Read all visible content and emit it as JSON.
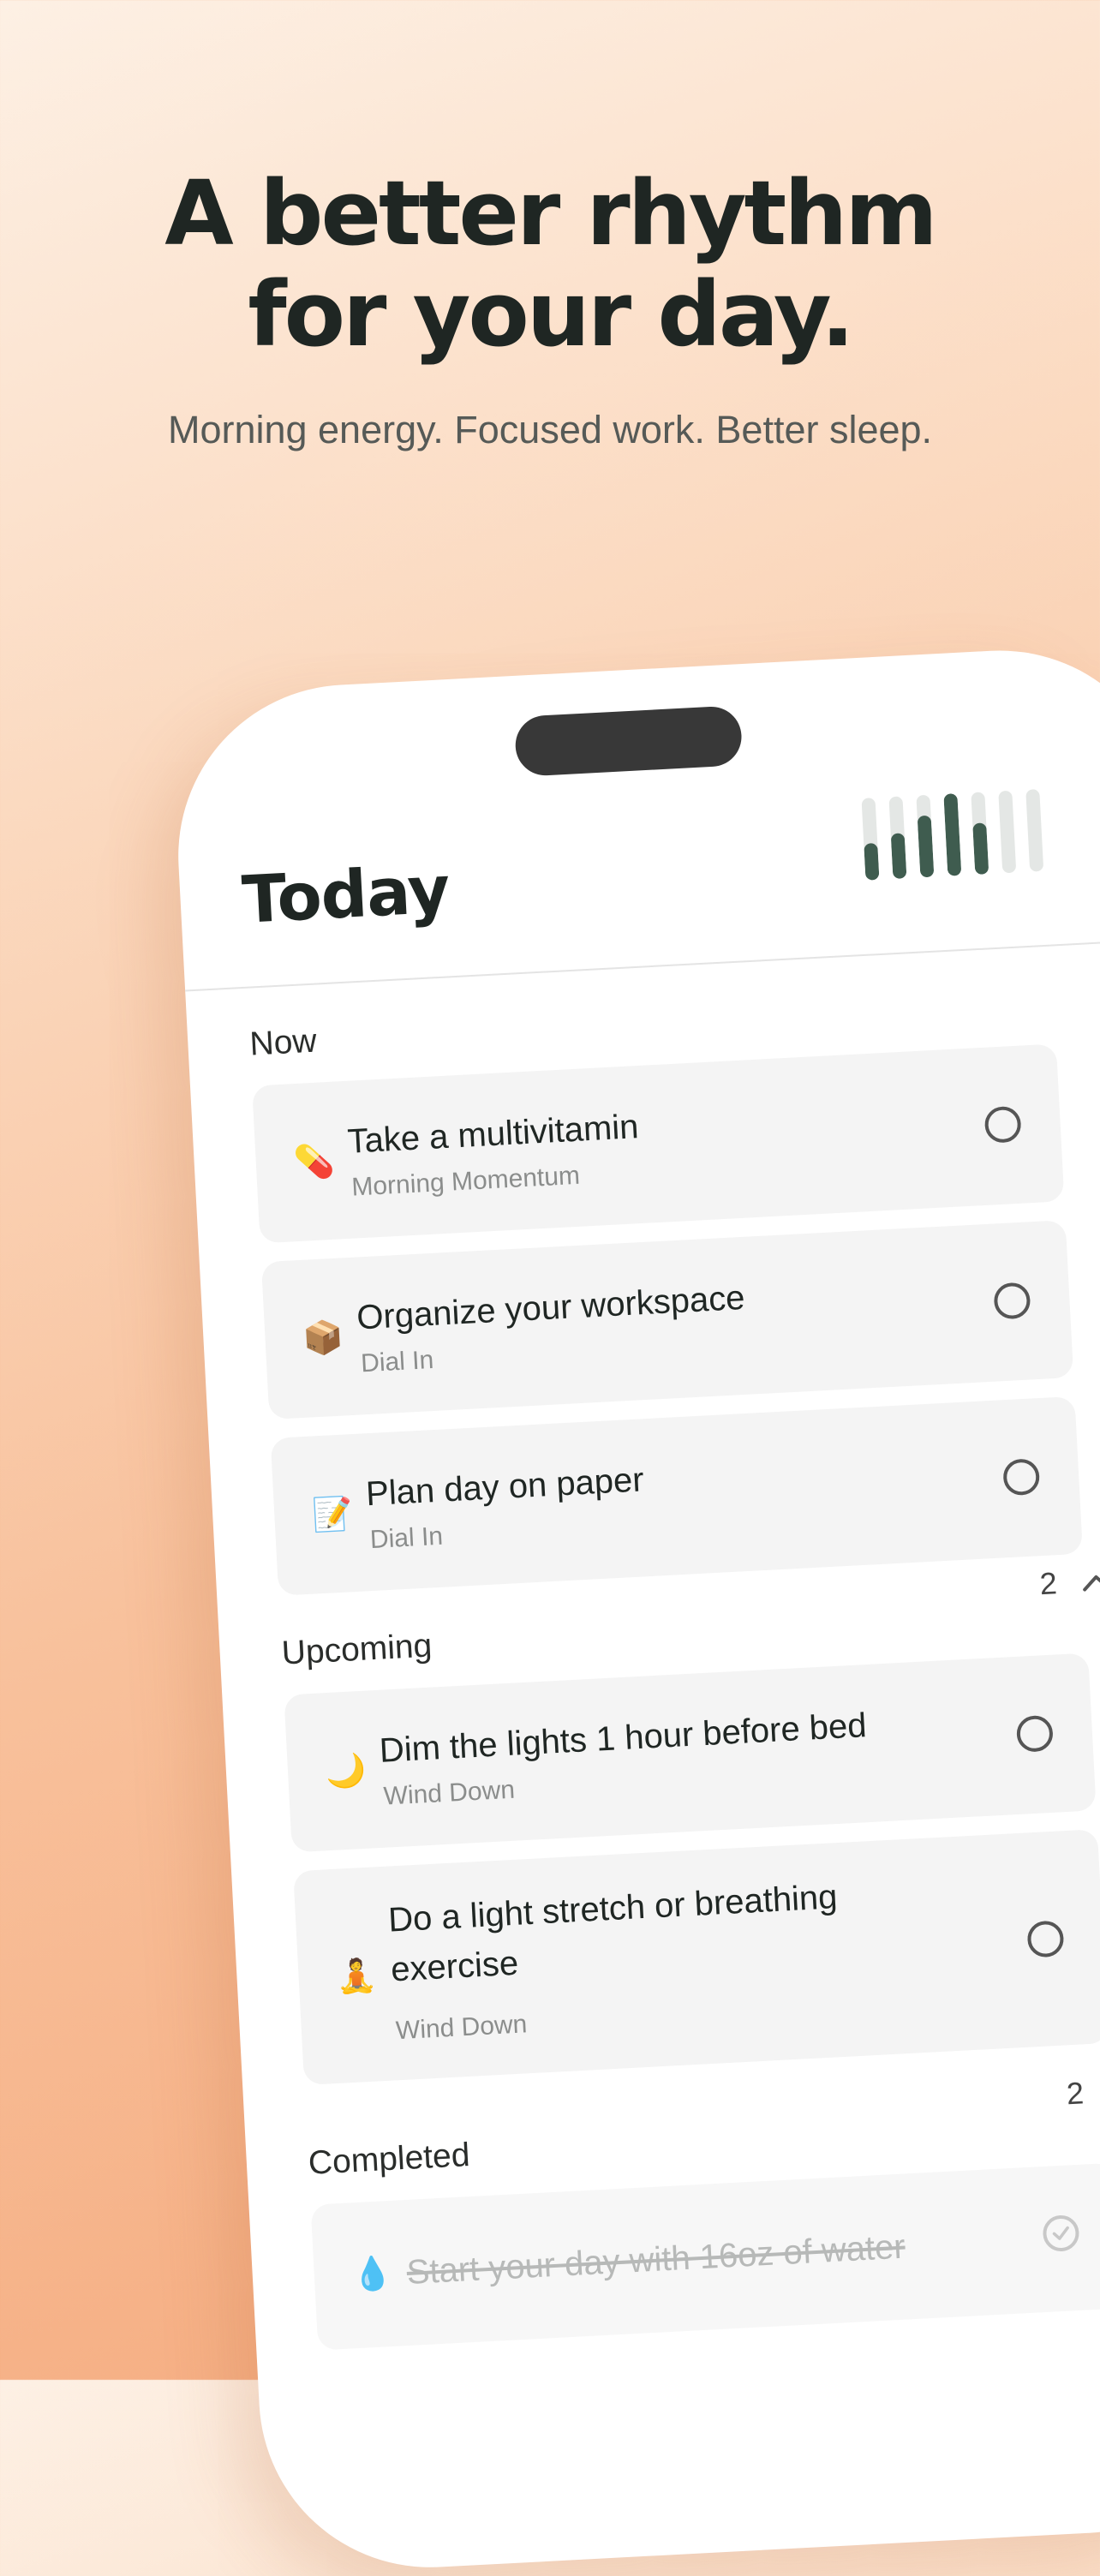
{
  "hero": {
    "headline_line1": "A better rhythm",
    "headline_line2": "for your day.",
    "subhead": "Morning energy. Focused work. Better sleep."
  },
  "app": {
    "title": "Today",
    "progress_bars": [
      0.45,
      0.55,
      0.75,
      1.0,
      0.62,
      0.0,
      0.0
    ],
    "accent_color": "#3f5c4f",
    "sections": {
      "now": {
        "label": "Now",
        "tasks": [
          {
            "emoji": "💊",
            "title": "Take a multivitamin",
            "routine": "Morning Momentum"
          },
          {
            "emoji": "📦",
            "title": "Organize your workspace",
            "routine": "Dial In"
          },
          {
            "emoji": "📝",
            "title": "Plan day on paper",
            "routine": "Dial In"
          }
        ]
      },
      "upcoming": {
        "label": "Upcoming",
        "count": "2",
        "tasks": [
          {
            "emoji": "🌙",
            "title": "Dim the lights 1 hour before bed",
            "routine": "Wind Down"
          },
          {
            "emoji": "🧘",
            "title": "Do a light stretch or breathing exercise",
            "routine": "Wind Down"
          }
        ]
      },
      "completed": {
        "label": "Completed",
        "count": "2",
        "tasks": [
          {
            "emoji": "💧",
            "title": "Start your day with 16oz of water"
          }
        ]
      }
    }
  }
}
